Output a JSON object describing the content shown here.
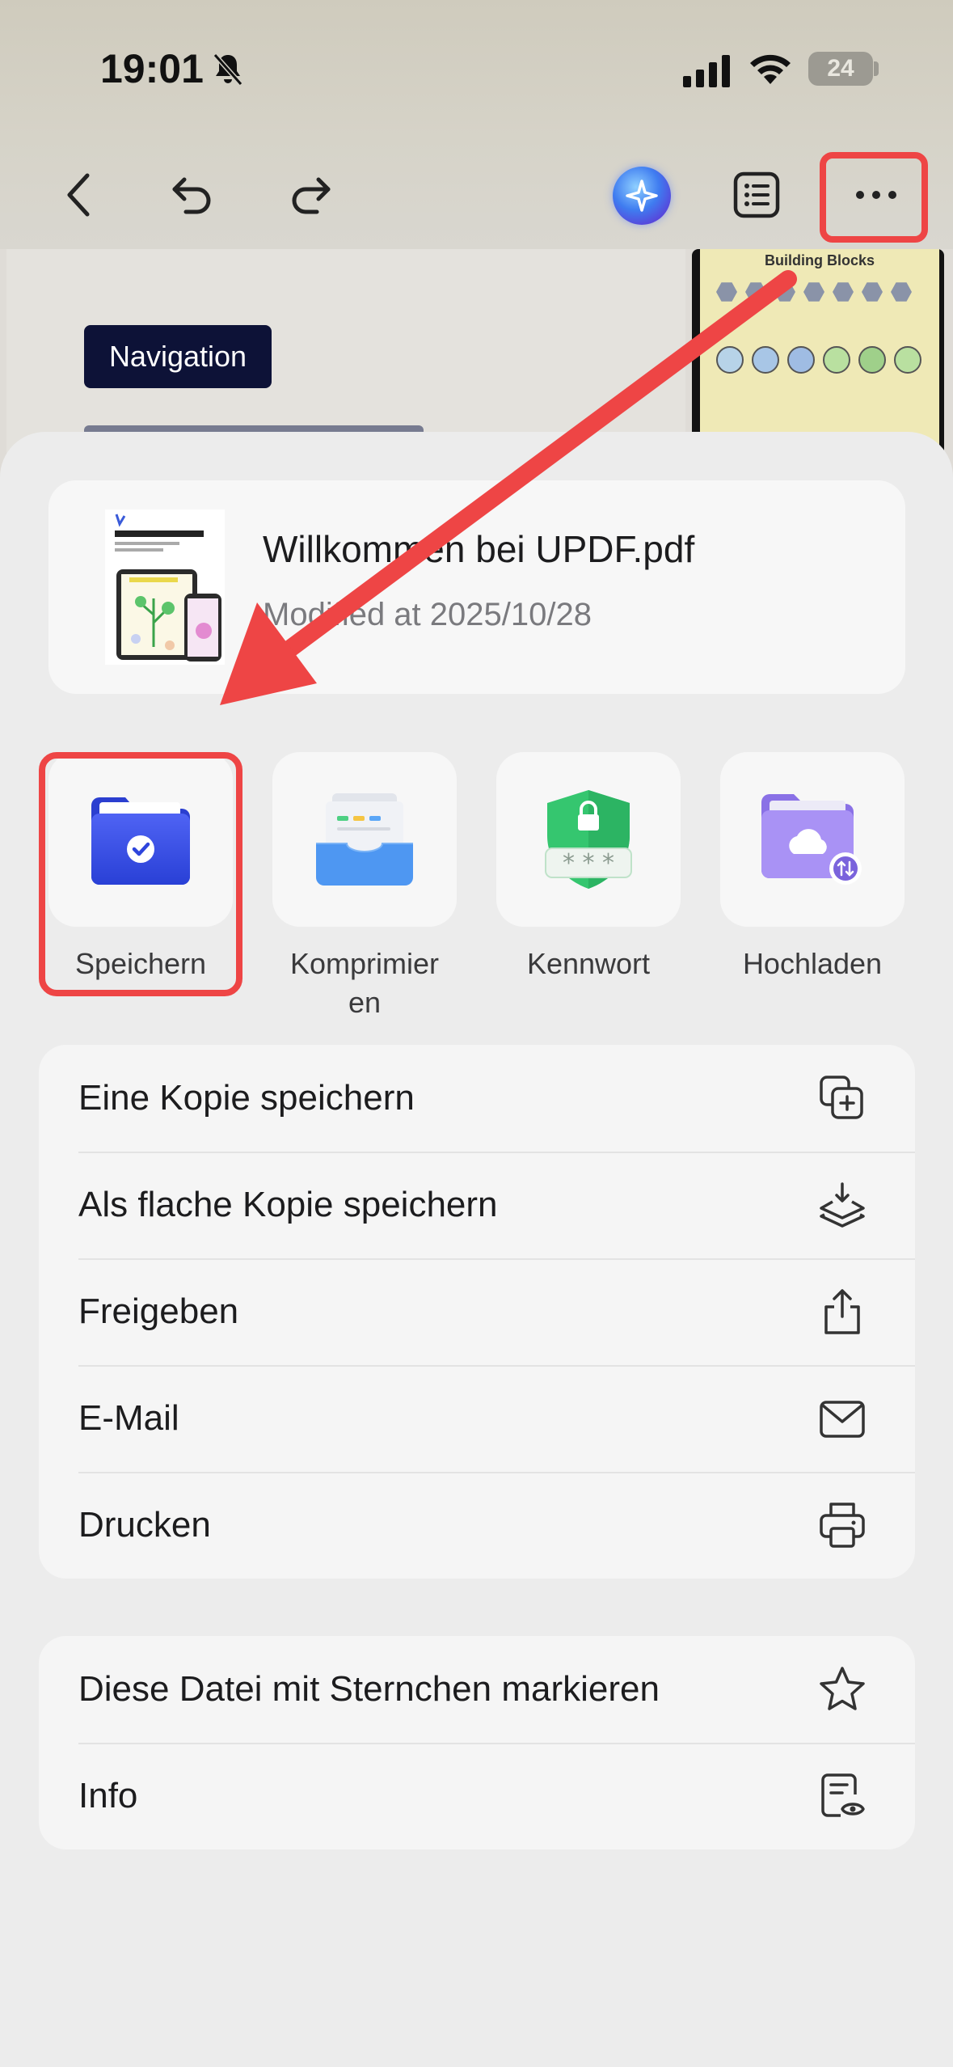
{
  "status_bar": {
    "time": "19:01",
    "battery": "24"
  },
  "toolbar": {
    "back_icon": "chevron-left-icon",
    "undo_icon": "undo-icon",
    "redo_icon": "redo-icon",
    "ai_icon": "ai-assistant-icon",
    "outline_icon": "list-icon",
    "more_icon": "ellipsis-icon"
  },
  "document": {
    "tag": "Navigation",
    "thumbnail_title": "Building Blocks"
  },
  "file": {
    "name": "Willkommen bei UPDF.pdf",
    "modified": "Modified at 2025/10/28",
    "thumb_title": "Willkommen bei UPDF"
  },
  "actions": [
    {
      "label": "Speichern",
      "icon": "folder-check-icon"
    },
    {
      "label": "Komprimier\nen",
      "icon": "archive-tray-icon"
    },
    {
      "label": "Kennwort",
      "icon": "shield-password-icon"
    },
    {
      "label": "Hochladen",
      "icon": "cloud-folder-icon"
    }
  ],
  "menu_group_1": [
    {
      "label": "Eine Kopie speichern",
      "icon": "copy-plus-icon"
    },
    {
      "label": "Als flache Kopie speichern",
      "icon": "layers-download-icon"
    },
    {
      "label": "Freigeben",
      "icon": "share-icon"
    },
    {
      "label": "E-Mail",
      "icon": "mail-icon"
    },
    {
      "label": "Drucken",
      "icon": "printer-icon"
    }
  ],
  "menu_group_2": [
    {
      "label": "Diese Datei mit Sternchen markieren",
      "icon": "star-icon"
    },
    {
      "label": "Info",
      "icon": "file-info-icon"
    }
  ],
  "colors": {
    "highlight": "#ee4545",
    "sheet_bg": "#ececec",
    "tile_bg": "#f7f7f7"
  }
}
